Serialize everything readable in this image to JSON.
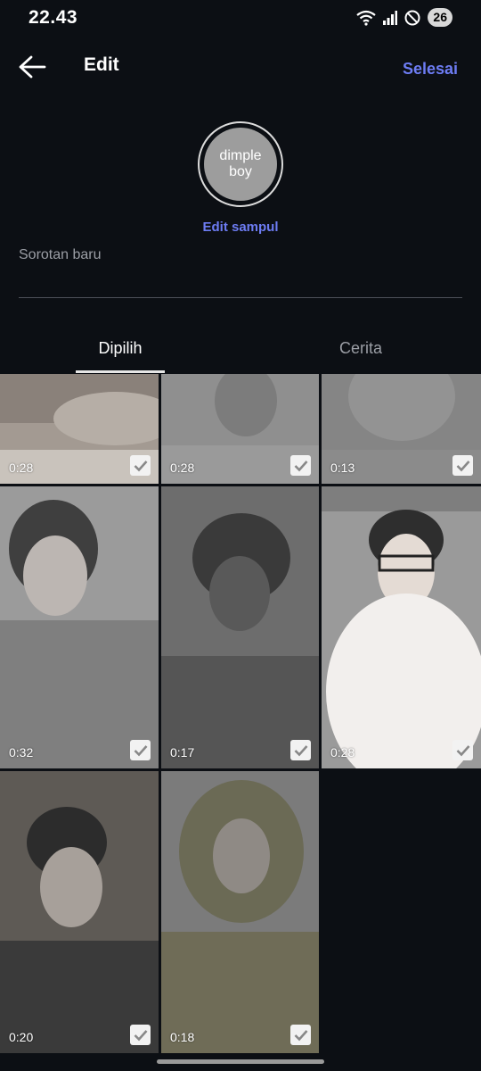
{
  "status_bar": {
    "time": "22.43",
    "battery": "26",
    "icons": [
      "wifi-icon",
      "signal-icon",
      "do-not-disturb-icon",
      "battery-icon"
    ]
  },
  "header": {
    "back_icon": "arrow-left-icon",
    "title": "Edit",
    "done_label": "Selesai"
  },
  "cover": {
    "text": "dimple boy",
    "edit_label": "Edit sampul"
  },
  "highlight_name": {
    "value": "",
    "placeholder": "Sorotan baru"
  },
  "tabs": [
    {
      "label": "Dipilih",
      "active": true
    },
    {
      "label": "Cerita",
      "active": false
    }
  ],
  "stories": [
    {
      "duration": "0:28",
      "selected": true
    },
    {
      "duration": "0:28",
      "selected": true
    },
    {
      "duration": "0:13",
      "selected": true
    },
    {
      "duration": "0:32",
      "selected": true
    },
    {
      "duration": "0:17",
      "selected": true
    },
    {
      "duration": "0:28",
      "selected": true
    },
    {
      "duration": "0:20",
      "selected": true
    },
    {
      "duration": "0:18",
      "selected": true
    }
  ],
  "colors": {
    "background": "#0c0f14",
    "accent": "#6d7cf3",
    "muted_text": "#9b9ea5",
    "cover_fill": "#9d9d9d"
  }
}
